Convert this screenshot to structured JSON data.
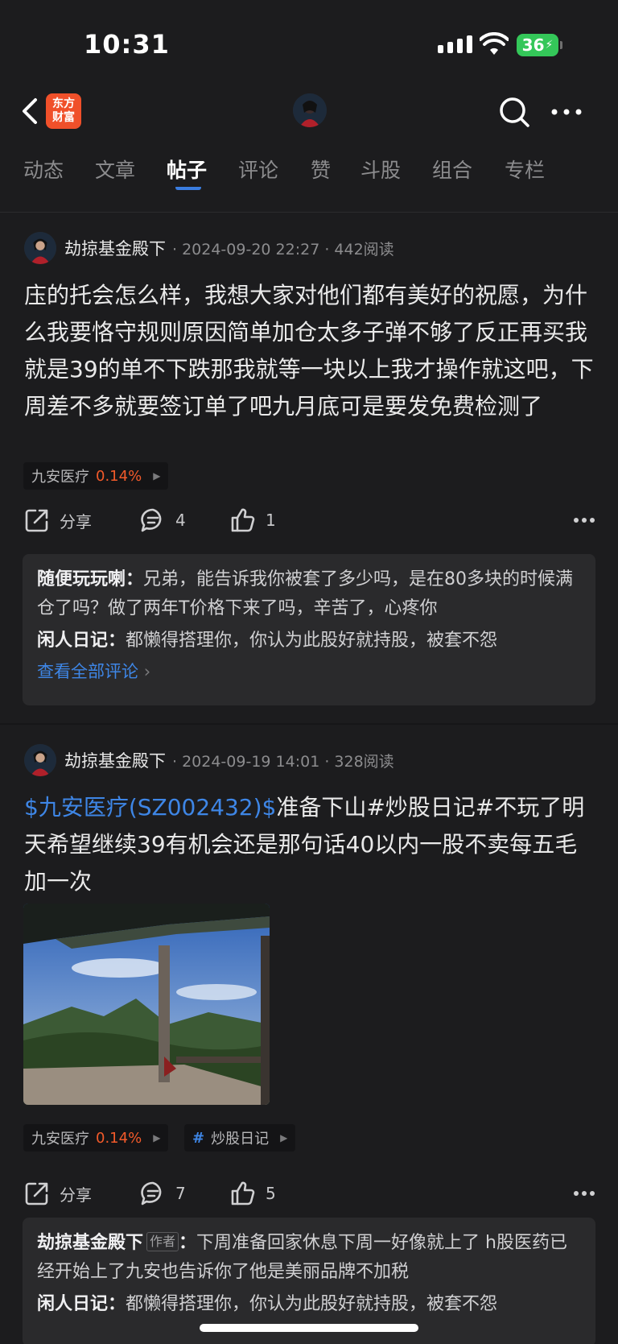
{
  "status": {
    "time": "10:31",
    "battery": "36"
  },
  "nav": {
    "logo_line1": "东方",
    "logo_line2": "财富"
  },
  "tabs": [
    {
      "label": "动态"
    },
    {
      "label": "文章"
    },
    {
      "label": "帖子"
    },
    {
      "label": "评论"
    },
    {
      "label": "赞"
    },
    {
      "label": "斗股"
    },
    {
      "label": "组合"
    },
    {
      "label": "专栏"
    }
  ],
  "posts": [
    {
      "author": "劫掠基金殿下",
      "meta": "· 2024-09-20 22:27 · 442阅读",
      "stock_link": "",
      "text": "庒的托会怎么样，我想大家对他们都有美好的祝愿，为什么我要恪守规则原因简单加仓太多子弹不够了反正再买我就是39的单不下跌那我就等一块以上我才操作就这吧，下周差不多就要签订单了吧九月底可是要发免费检测了",
      "tag_stock": "九安医疗",
      "tag_pct": "0.14%",
      "share_label": "分享",
      "comment_count": "4",
      "like_count": "1",
      "comments": [
        {
          "user": "随便玩玩喇",
          "text": "兄弟，能告诉我你被套了多少吗，是在80多块的时候满仓了吗？做了两年T价格下来了吗，辛苦了，心疼你"
        },
        {
          "user": "闲人日记",
          "text": "都懒得搭理你，你认为此股好就持股，被套不怨"
        }
      ],
      "view_all": "查看全部评论"
    },
    {
      "author": "劫掠基金殿下",
      "meta": "· 2024-09-19 14:01 · 328阅读",
      "stock_link": "$九安医疗(SZ002432)$",
      "text": "准备下山#炒股日记#不玩了明天希望继续39有机会还是那句话40以内一股不卖每五毛加一次",
      "tag_stock": "九安医疗",
      "tag_pct": "0.14%",
      "tag_topic": "炒股日记",
      "share_label": "分享",
      "comment_count": "7",
      "like_count": "5",
      "comments": [
        {
          "user": "劫掠基金殿下",
          "badge": "作者",
          "text": "下周准备回家休息下周一好像就上了 h股医药已经开始上了九安也告诉你了他是美丽品牌不加税"
        },
        {
          "user": "闲人日记",
          "text": "都懒得搭理你，你认为此股好就持股，被套不怨"
        }
      ]
    }
  ],
  "colors": {
    "accent": "#3e86e6",
    "up": "#f25a2a",
    "brand": "#f0502a"
  }
}
